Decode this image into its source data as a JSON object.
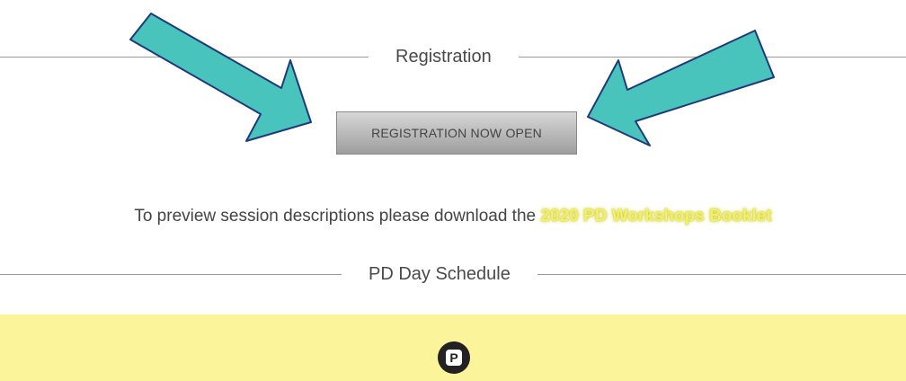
{
  "registration": {
    "heading": "Registration",
    "button_label": "REGISTRATION NOW OPEN"
  },
  "preview": {
    "text": "To preview session descriptions please download the ",
    "link_text": "2020 PD Workshops Booklet"
  },
  "schedule": {
    "heading": "PD Day Schedule",
    "badge_letter": "P"
  },
  "colors": {
    "arrow_fill": "#48c4bd",
    "arrow_stroke": "#1f3a7a",
    "band": "#fbf49a",
    "link": "#f2f26a"
  },
  "icons": {
    "left_arrow": "arrow-pointing-down-right",
    "right_arrow": "arrow-pointing-down-left",
    "badge": "p-badge-icon"
  }
}
